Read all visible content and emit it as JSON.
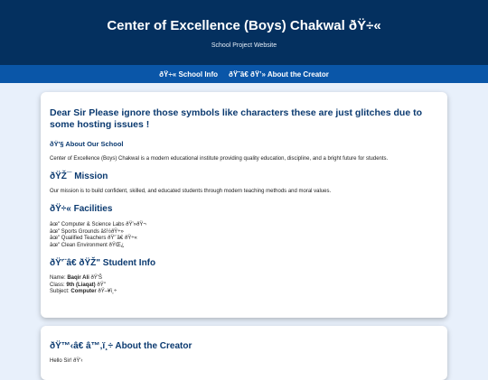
{
  "header": {
    "title": "Center of Excellence (Boys) Chakwal ðŸ÷«",
    "subtitle": "School Project Website"
  },
  "nav": {
    "items": [
      "ðŸ÷« School Info",
      "ðŸ˜â€ ðŸ’» About the Creator"
    ]
  },
  "main": {
    "notice": "Dear Sir Please ignore those symbols like characters these are just glitches due to some hosting issues !",
    "about_heading": "ðŸ'§ About Our School",
    "about_text": "Center of Excellence (Boys) Chakwal is a modern educational institute providing quality education, discipline, and a bright future for students.",
    "mission_heading": "ðŸŽ¯ Mission",
    "mission_text": "Our mission is to build confident, skilled, and educated students through modern teaching methods and moral values.",
    "facilities_heading": "ðŸ÷« Facilities",
    "facilities": [
      "âœ\" Computer & Science Labs ðŸ'»ðŸ¬",
      "âœ\" Sports Grounds âš½ðŸ÷»",
      "âœ\" Qualified Teachers ðŸ'¨â€  ðŸ÷«",
      "âœ\" Clean Environment ðŸŒ¿"
    ],
    "student_heading": "ðŸ'¨â€   ðŸŽ\" Student Info",
    "student": {
      "name_label": "Name: ",
      "name_value": "Baqir Ali",
      "name_suffix": " ðŸ'Š",
      "class_label": "Class: ",
      "class_value": "9th (Liaqat)",
      "class_suffix": " ðŸ\"",
      "subject_label": "Subject: ",
      "subject_value": "Computer",
      "subject_suffix": " ðŸ–¥ï¸÷"
    }
  },
  "creator": {
    "heading": "ðŸ™‹â€  â™‚ï¸÷ About the Creator",
    "text": "Hello Sir! ðŸ'‹"
  }
}
